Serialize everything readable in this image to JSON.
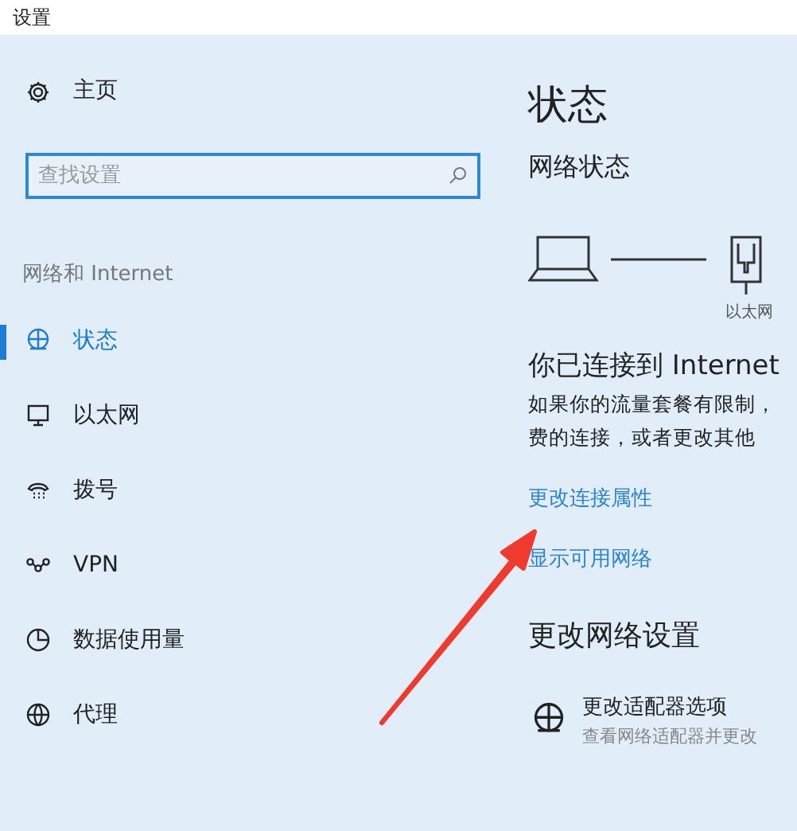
{
  "window": {
    "title": "设置"
  },
  "sidebar": {
    "home": "主页",
    "search": {
      "placeholder": "查找设置"
    },
    "section": "网络和 Internet",
    "items": [
      {
        "label": "状态",
        "kind": "status",
        "selected": true
      },
      {
        "label": "以太网",
        "kind": "ethernet",
        "selected": false
      },
      {
        "label": "拨号",
        "kind": "dialup",
        "selected": false
      },
      {
        "label": "VPN",
        "kind": "vpn",
        "selected": false
      },
      {
        "label": "数据使用量",
        "kind": "data",
        "selected": false
      },
      {
        "label": "代理",
        "kind": "proxy",
        "selected": false
      }
    ]
  },
  "main": {
    "title": "状态",
    "subtitle": "网络状态",
    "device_label": "以太网",
    "connected": "你已连接到 Internet",
    "description": [
      "如果你的流量套餐有限制，",
      "费的连接，或者更改其他"
    ],
    "links": [
      "更改连接属性",
      "显示可用网络"
    ],
    "settings_heading": "更改网络设置",
    "options": [
      {
        "title": "更改适配器选项",
        "subtitle": "查看网络适配器并更改"
      }
    ]
  }
}
